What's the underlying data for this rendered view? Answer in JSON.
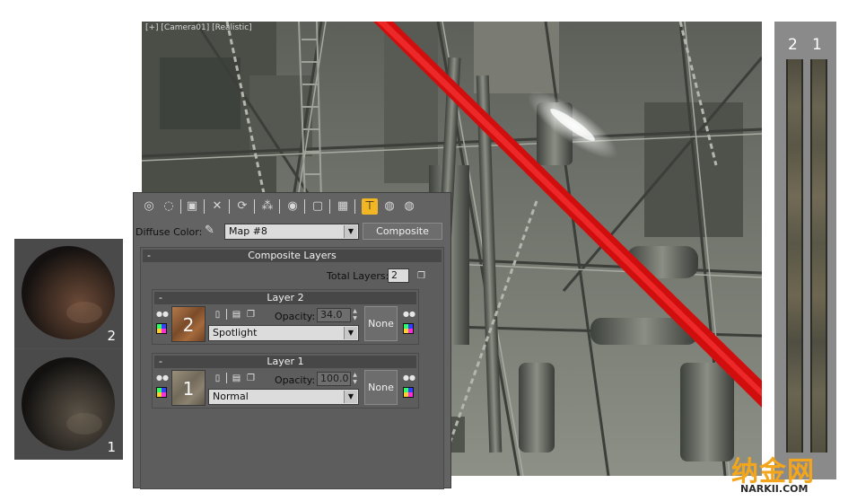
{
  "viewport": {
    "label": "[+] [Camera01] [Realistic]"
  },
  "spheres": {
    "items": [
      {
        "number": "2"
      },
      {
        "number": "1"
      }
    ]
  },
  "strip": {
    "numbers": [
      "2",
      "1"
    ]
  },
  "toolbar": {
    "icons": [
      "get-material-icon",
      "put-to-scene-icon",
      "assign-material-icon",
      "reset-map-icon",
      "make-unique-icon",
      "put-to-library-icon",
      "material-id-channel-icon",
      "show-map-icon",
      "show-end-result-icon",
      "go-to-parent-icon",
      "go-forward-sibling-icon",
      "background-icon"
    ]
  },
  "diffuse": {
    "label": "Diffuse Color:",
    "map_value": "Map #8",
    "type_button": "Composite"
  },
  "composite_layers": {
    "title": "Composite Layers",
    "collapse": "-",
    "total_layers_label": "Total Layers:",
    "total_layers_value": "2"
  },
  "layers": [
    {
      "title": "Layer 2",
      "collapse": "-",
      "swatch_number": "2",
      "opacity_label": "Opacity:",
      "opacity_value": "34.0",
      "blend_mode": "Spotlight",
      "mask_button": "None"
    },
    {
      "title": "Layer 1",
      "collapse": "-",
      "swatch_number": "1",
      "opacity_label": "Opacity:",
      "opacity_value": "100.0",
      "blend_mode": "Normal",
      "mask_button": "None"
    }
  ],
  "watermark": {
    "logo": "纳金网",
    "url": "NARKII.COM"
  },
  "colors": {
    "panel_bg": "#636363",
    "active_tool": "#f2b624",
    "scene_red_beam": "#d10e0e",
    "watermark_orange": "#f3a51c"
  }
}
